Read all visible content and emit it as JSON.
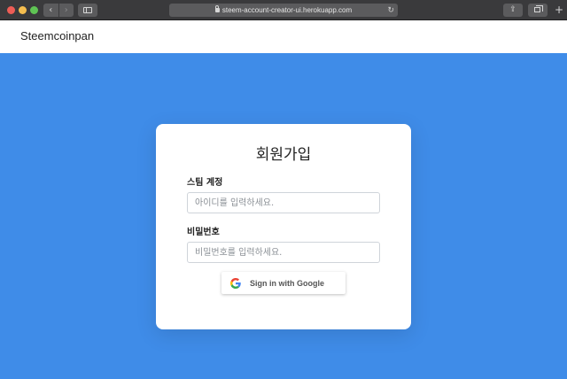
{
  "browser": {
    "url": "steem-account-creator-ui.herokuapp.com",
    "back_glyph": "‹",
    "forward_glyph": "›",
    "reload_glyph": "↻",
    "share_glyph": "⇪",
    "newtab_glyph": "+"
  },
  "header": {
    "brand": "Steemcoinpan"
  },
  "signup": {
    "title": "회원가입",
    "account": {
      "label": "스팀 계정",
      "placeholder": "아이디를 입력하세요.",
      "value": ""
    },
    "password": {
      "label": "비밀번호",
      "placeholder": "비밀번호를 입력하세요.",
      "value": ""
    },
    "google_button": "Sign in with Google"
  },
  "colors": {
    "background": "#3f8ce8",
    "card": "#ffffff",
    "google_blue": "#4285F4",
    "google_red": "#EA4335",
    "google_yellow": "#FBBC05",
    "google_green": "#34A853"
  },
  "icons": {
    "lock": "lock-icon",
    "reload": "reload-icon",
    "google": "google-g-icon"
  }
}
